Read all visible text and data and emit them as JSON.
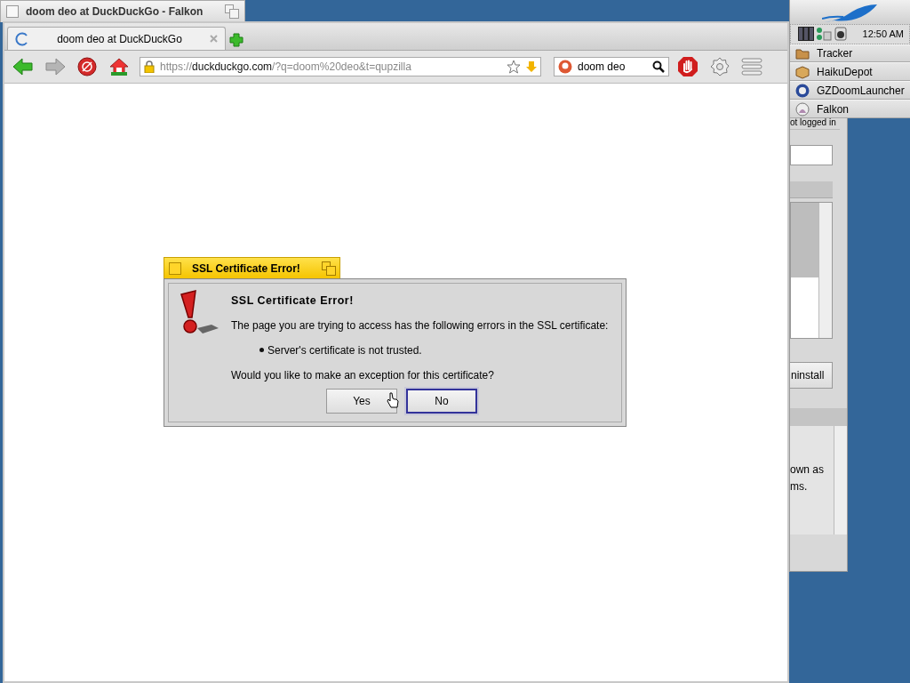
{
  "browser_window": {
    "title": "doom deo at DuckDuckGo - Falkon",
    "tabs": [
      {
        "label": "doom deo at DuckDuckGo",
        "selected": true
      }
    ],
    "url": [
      "https://",
      "duckduckgo.com",
      "/?q=doom%20deo&t=qupzilla"
    ],
    "search": {
      "value": "doom deo"
    }
  },
  "dialog": {
    "title": "SSL Certificate Error!",
    "heading": "SSL Certificate Error!",
    "message": "The page you are trying to access has the following errors in the SSL certificate:",
    "errors": [
      "Server's certificate is not trusted."
    ],
    "question": "Would you like to make an exception for this certificate?",
    "buttons": [
      {
        "label": "Yes",
        "default": false
      },
      {
        "label": "No",
        "default": true
      }
    ]
  },
  "deskbar": {
    "clock": "12:50 AM",
    "apps": [
      "Tracker",
      "HaikuDepot",
      "GZDoomLauncher",
      "Falkon"
    ]
  },
  "background_window": {
    "status": "ot logged in",
    "button": "ninstall",
    "description": [
      "own as",
      "ms."
    ]
  }
}
